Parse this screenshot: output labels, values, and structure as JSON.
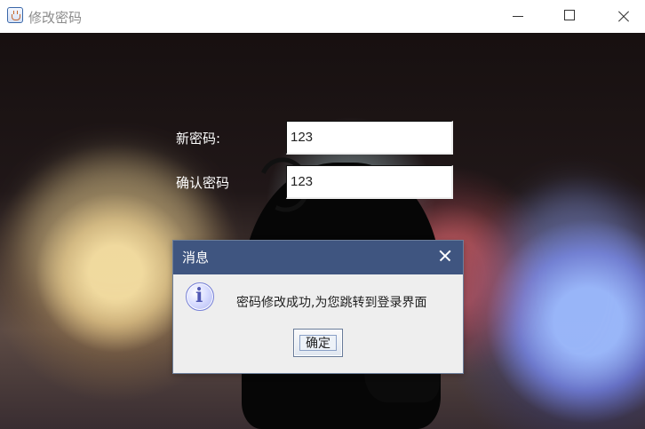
{
  "window": {
    "title": "修改密码",
    "icon": "java-cup-icon",
    "controls": {
      "minimize": "minimize-icon",
      "maximize": "maximize-icon",
      "close": "close-icon"
    }
  },
  "form": {
    "new_password_label": "新密码:",
    "new_password_value": "123",
    "confirm_password_label": "确认密码",
    "confirm_password_value": "123"
  },
  "dialog": {
    "title": "消息",
    "message": "密码修改成功,为您跳转到登录界面",
    "ok_label": "确定",
    "icon": "info-icon",
    "close_icon": "close-icon"
  },
  "colors": {
    "dialog_title_bg": "#3f5580",
    "dialog_bg": "#eeeeee",
    "window_title": "#8b8b8b"
  }
}
